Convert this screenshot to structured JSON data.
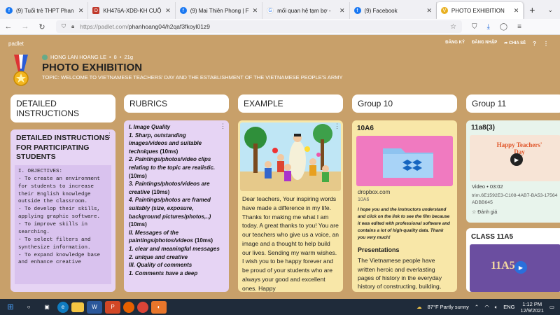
{
  "browser": {
    "tabs": [
      {
        "label": "(9) Tuổi trẻ THPT Phan",
        "icon": "f"
      },
      {
        "label": "KH476A-XDĐ-KH CUỘ",
        "icon": "D"
      },
      {
        "label": "(9) Mai Thiên Phong | F",
        "icon": "f"
      },
      {
        "label": "mối quan hệ tạm bợ -",
        "icon": "G"
      },
      {
        "label": "(9) Facebook",
        "icon": "f"
      },
      {
        "label": "PHOTO EXHIBITION",
        "icon": "V"
      }
    ],
    "url_host": "https://padlet.com/",
    "url_path": "phanhoang04/h2qaf3fkoyl01z9"
  },
  "padlet": {
    "logo": "padlet",
    "actions": [
      "ĐĂNG KÝ",
      "ĐĂNG NHẬP",
      "➦ CHIA SẺ",
      "?",
      "⋮"
    ],
    "author": "HONG LAN HOANG LE",
    "score": "8",
    "age": "21g",
    "title": "PHOTO EXHIBITION",
    "topic": "TOPIC: WELCOME TO VIETNAMESE TEACHERS' DAY AND THE ESTABLISHMENT OF THE VIETNAMESE PEOPLE'S ARMY"
  },
  "columns": {
    "c1": "DETAILED INSTRUCTIONS",
    "c2": "RUBRICS",
    "c3": "EXAMPLE",
    "c4": "Group 10",
    "c5": "Group 11"
  },
  "instr": {
    "title": "DETAILED INSTRUCTIONS FOR PARTICIPATING STUDENTS",
    "body": "I. OBJECTIVES:\n- To create an environment for students to increase their English knowledge outside the classroom.\n- To develop their skills, applying graphic software.\n- To improve skills in searching.\n- To select filters and synthesize information.\n- To expand knowledge base and enhance creative"
  },
  "rubric": [
    {
      "t": "I.  Image Quality",
      "i": true
    },
    {
      "t": "1. Sharp, outstanding images/videos and suitable techniques",
      "s": " (10ms)"
    },
    {
      "t": "2. Paintings/photos/video clips relating to the topic are realistic.",
      "s": " (10ms)"
    },
    {
      "t": "3. Paintings/photos/videos are creative",
      "s": " (10ms)"
    },
    {
      "t": "4. Paintings/photos are framed suitably (size, exposure, background pictures/photos,..)",
      "s": " (10ms)"
    },
    {
      "t": "II. Messages of the paintings/photos/videos",
      "s": " (10ms)"
    },
    {
      "t": "1.  clear  and meaningful messages",
      "s": ""
    },
    {
      "t": "2. unique and creative",
      "s": ""
    },
    {
      "t": "III. Quality of comments",
      "s": ""
    },
    {
      "t": "1. Comments have a deep",
      "s": ""
    }
  ],
  "example": {
    "text": "Dear teachers, Your inspiring words have made a difference in my life. Thanks for making me what I am today. A great thanks to you! You are our teachers who give us a voice, an image and a thought to help build our lives. Sending my warm wishes. I wish you to be happy forever and be proud of your students who are always your good and excellent ones. Happy"
  },
  "group10": {
    "title": "10A6",
    "link": "dropbox.com",
    "sub": "10A6",
    "note": "I hope you and the instructors understand and click on the link to see the film because it was edited with professional software and contains a lot of high-quality data. Thank you very much!",
    "pres_title": "Presentations",
    "pres_body": "The Vietnamese people have written heroic and everlasting pages of history in the everyday history of constructing, building,"
  },
  "group11": {
    "title": "11a8(3)",
    "video_label": "Video • 03:02",
    "thumb_text": "Happy Teachers' Day",
    "file": "trim.6E1592E3-C108-4AB7-BA53-17564ADBB645",
    "rate": "Đánh giá",
    "class": "CLASS 11A5",
    "class_thumb": "11A5"
  },
  "taskbar": {
    "weather": "87°F  Partly sunny",
    "lang": "ENG",
    "time": "1:12 PM",
    "date": "12/9/2021"
  }
}
